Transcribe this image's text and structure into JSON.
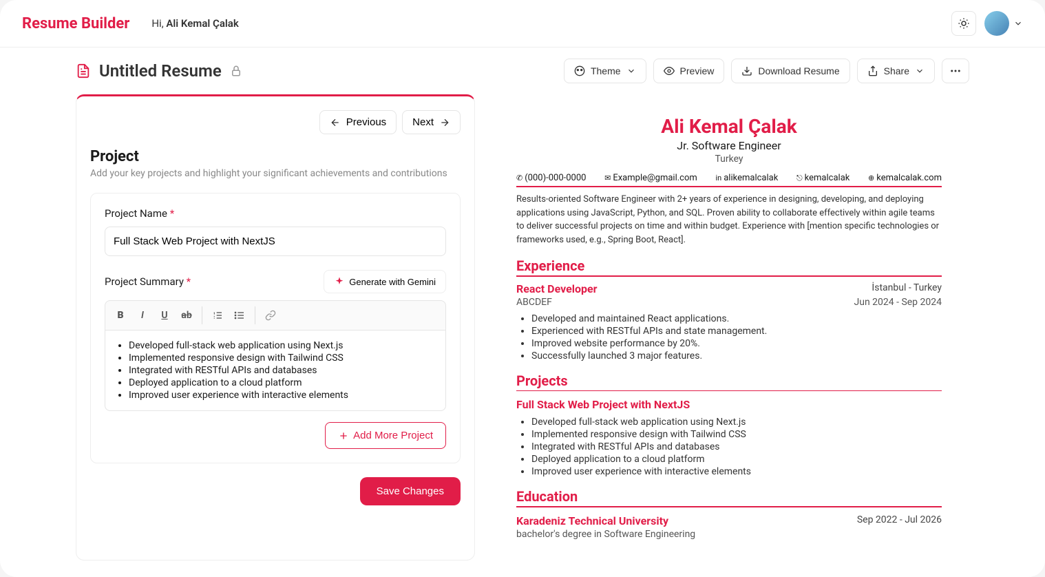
{
  "header": {
    "logo": "Resume Builder",
    "greeting_prefix": "Hi,",
    "user_name": "Ali Kemal Çalak"
  },
  "toolbar": {
    "title": "Untitled Resume",
    "theme": "Theme",
    "preview": "Preview",
    "download": "Download Resume",
    "share": "Share"
  },
  "editor": {
    "previous": "Previous",
    "next": "Next",
    "section_title": "Project",
    "section_desc": "Add your key projects and highlight your significant achievements and contributions",
    "project_name_label": "Project Name",
    "project_name_value": "Full Stack Web Project with NextJS",
    "summary_label": "Project Summary",
    "gemini_label": "Generate with Gemini",
    "bullets": [
      "Developed full-stack web application using Next.js",
      "Implemented responsive design with Tailwind CSS",
      "Integrated with RESTful APIs and databases",
      "Deployed application to a cloud platform",
      "Improved user experience with interactive elements"
    ],
    "add_more": "Add More Project",
    "save": "Save Changes"
  },
  "preview": {
    "name": "Ali Kemal Çalak",
    "role": "Jr. Software Engineer",
    "location": "Turkey",
    "contacts": {
      "phone": "(000)-000-0000",
      "email": "Example@gmail.com",
      "linkedin": "alikemalcalak",
      "github": "kemalcalak",
      "site": "kemalcalak.com"
    },
    "summary": "Results-oriented Software Engineer with 2+ years of experience in designing, developing, and deploying applications using JavaScript, Python, and SQL. Proven ability to collaborate effectively within agile teams to deliver successful projects on time and within budget. Experience with [mention specific technologies or frameworks used, e.g., Spring Boot, React].",
    "sections": {
      "experience": "Experience",
      "projects": "Projects",
      "education": "Education"
    },
    "job": {
      "title": "React Developer",
      "location": "İstanbul - Turkey",
      "company": "ABCDEF",
      "dates": "Jun 2024 - Sep 2024",
      "bullets": [
        "Developed and maintained React applications.",
        "Experienced with RESTful APIs and state management.",
        "Improved website performance by 20%.",
        "Successfully launched 3 major features."
      ]
    },
    "project": {
      "title": "Full Stack Web Project with NextJS",
      "bullets": [
        "Developed full-stack web application using Next.js",
        "Implemented responsive design with Tailwind CSS",
        "Integrated with RESTful APIs and databases",
        "Deployed application to a cloud platform",
        "Improved user experience with interactive elements"
      ]
    },
    "edu": {
      "school": "Karadeniz Technical University",
      "dates": "Sep 2022 - Jul 2026",
      "degree": "bachelor's degree in Software Engineering"
    }
  }
}
